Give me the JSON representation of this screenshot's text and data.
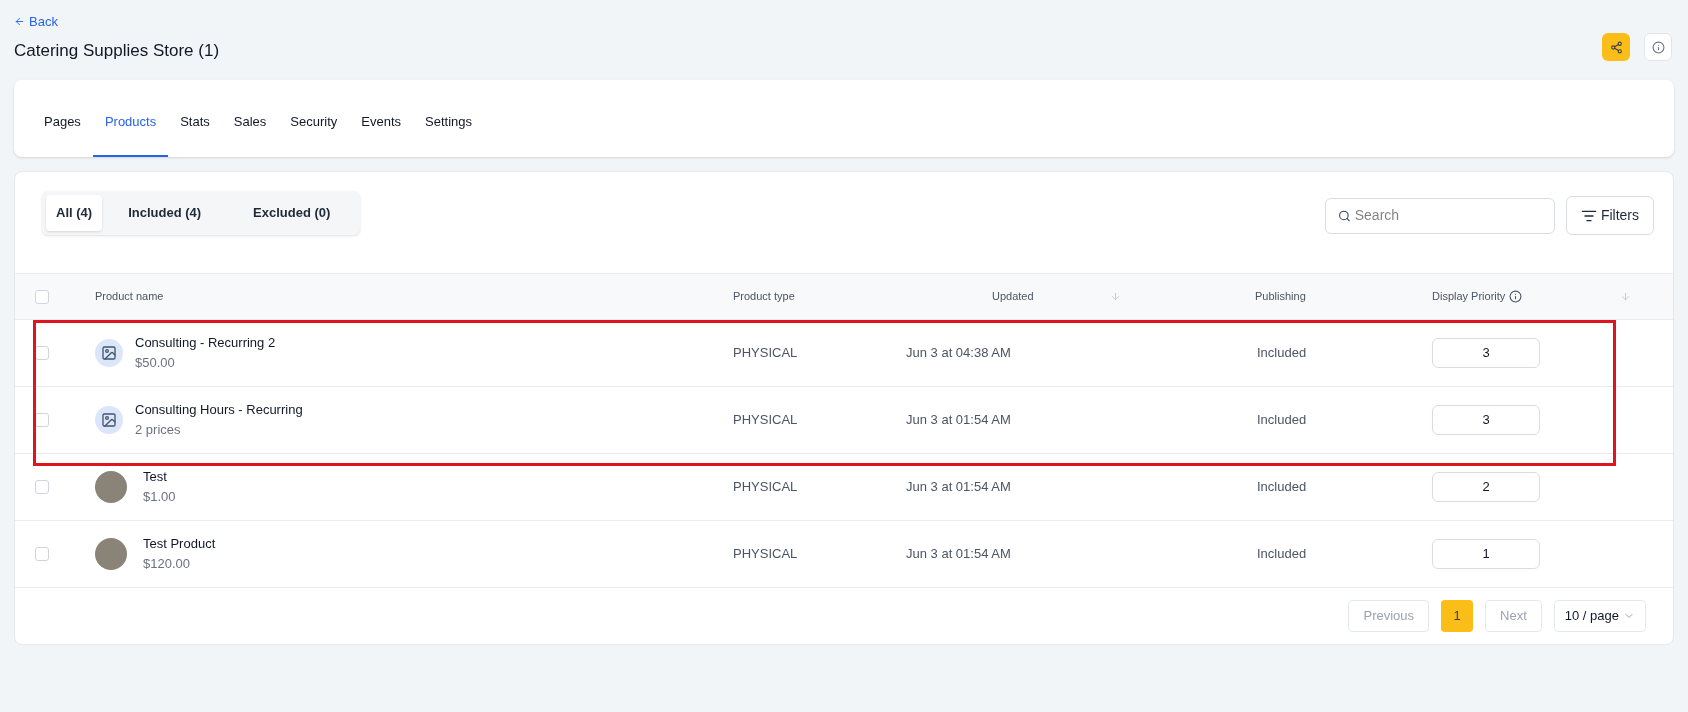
{
  "header": {
    "back": "Back",
    "title": "Catering Supplies Store (1)"
  },
  "tabs": [
    {
      "label": "Pages",
      "selected": false
    },
    {
      "label": "Products",
      "selected": true
    },
    {
      "label": "Stats",
      "selected": false
    },
    {
      "label": "Sales",
      "selected": false
    },
    {
      "label": "Security",
      "selected": false
    },
    {
      "label": "Events",
      "selected": false
    },
    {
      "label": "Settings",
      "selected": false
    }
  ],
  "filter_tabs": [
    {
      "label": "All (4)",
      "selected": true
    },
    {
      "label": "Included (4)",
      "selected": false
    },
    {
      "label": "Excluded (0)",
      "selected": false
    }
  ],
  "search": {
    "placeholder": "Search"
  },
  "filters_button": "Filters",
  "table": {
    "select_all_checked": false,
    "columns": [
      "Product name",
      "Product type",
      "Updated",
      "Publishing",
      "Display Priority"
    ],
    "rows": [
      {
        "name": "Consulting - Recurring 2",
        "price": "$50.00",
        "kind": "icon",
        "type": "PHYSICAL",
        "updated": "Jun 3 at 04:38 AM",
        "publishing": "Included",
        "priority": "3",
        "checked": false,
        "highlighted": true
      },
      {
        "name": "Consulting Hours - Recurring",
        "price": "2 prices",
        "kind": "icon",
        "type": "PHYSICAL",
        "updated": "Jun 3 at 01:54 AM",
        "publishing": "Included",
        "priority": "3",
        "checked": false,
        "highlighted": true
      },
      {
        "name": "Test",
        "price": "$1.00",
        "kind": "photo",
        "type": "PHYSICAL",
        "updated": "Jun 3 at 01:54 AM",
        "publishing": "Included",
        "priority": "2",
        "checked": false,
        "highlighted": false
      },
      {
        "name": "Test Product",
        "price": "$120.00",
        "kind": "photo",
        "type": "PHYSICAL",
        "updated": "Jun 3 at 01:54 AM",
        "publishing": "Included",
        "priority": "1",
        "checked": false,
        "highlighted": false
      }
    ]
  },
  "pagination": {
    "previous": "Previous",
    "pages": [
      {
        "label": "1",
        "selected": true
      }
    ],
    "next": "Next",
    "page_size": "10 / page"
  }
}
